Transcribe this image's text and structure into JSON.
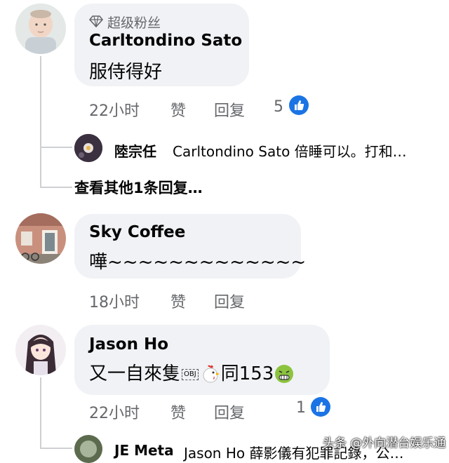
{
  "comments": [
    {
      "badge_text": "超级粉丝",
      "badge_icon": "diamond-icon",
      "author": "Carltondino Sato",
      "text": "服侍得好",
      "time": "22小时",
      "like_label": "赞",
      "reply_label": "回复",
      "reaction_count": "5"
    },
    {
      "author": "Sky Coffee",
      "text": "嘩~~~~~~~~~~~~~",
      "time": "18小时",
      "like_label": "赞",
      "reply_label": "回复"
    },
    {
      "author": "Jason Ho",
      "text_part1": "又一自來隻",
      "obj_label": "OBJ",
      "text_part2": "同153",
      "time": "22小时",
      "like_label": "赞",
      "reply_label": "回复",
      "reaction_count": "1"
    }
  ],
  "reply_preview_1": {
    "author": "陸宗任",
    "text": "Carltondino Sato 倍睡可以。打和…"
  },
  "view_more_replies": "查看其他1条回复…",
  "reply_preview_2": {
    "author": "JE Meta",
    "text": "Jason Ho 薛影儀有犯罪記錄，公…"
  },
  "watermark": "头条 @外向潜台娱乐通",
  "colors": {
    "bubble": "#f0f2f5",
    "meta_text": "#65676b",
    "like_blue": "#1b74e4",
    "thread_line": "#ced0d4"
  }
}
